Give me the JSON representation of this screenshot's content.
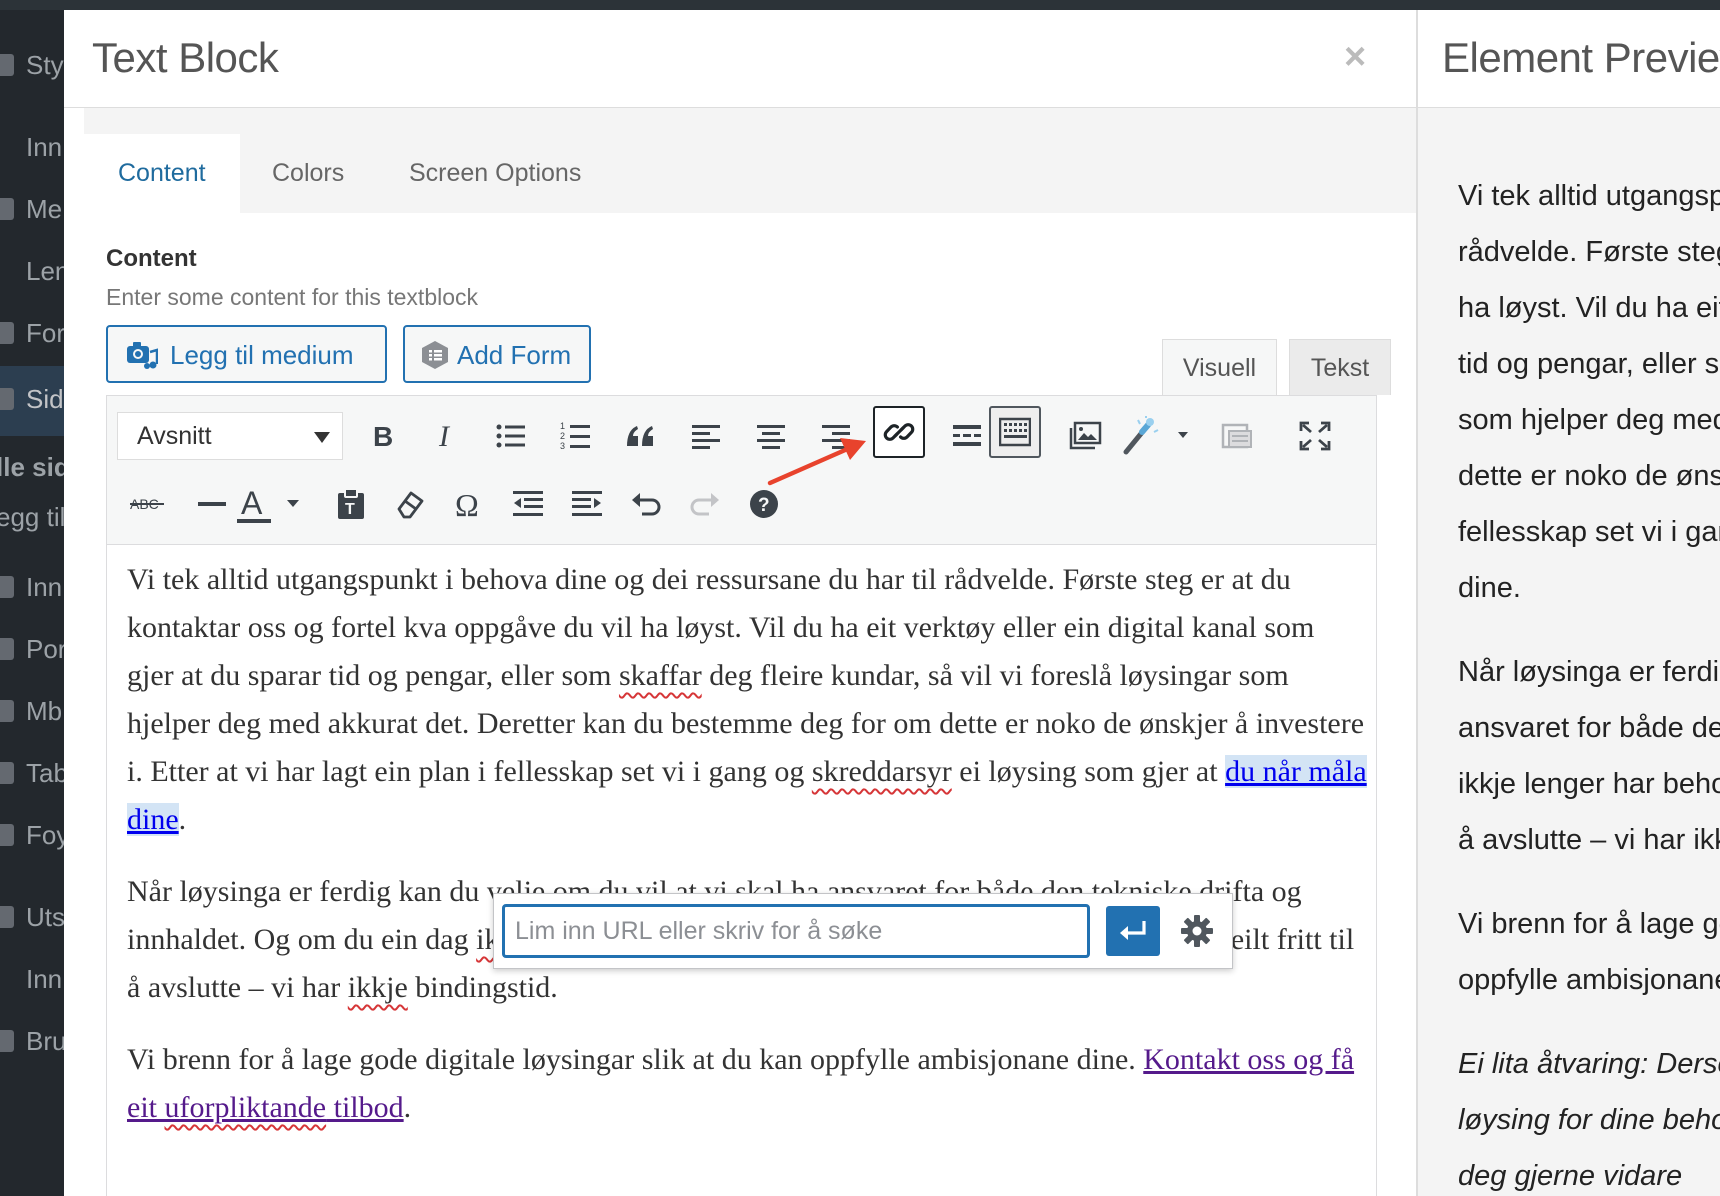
{
  "sidebar": {
    "items": [
      "Sty",
      "Inn",
      "Me",
      "Len",
      "For",
      "Sid",
      "lle sid",
      "egg til",
      "Inn",
      "Por",
      "Mb",
      "Tab",
      "Foy",
      "Uts",
      "Inn",
      "Bru"
    ]
  },
  "modal": {
    "title": "Text Block",
    "close_label": "×",
    "tabs": [
      {
        "label": "Content"
      },
      {
        "label": "Colors"
      },
      {
        "label": "Screen Options"
      }
    ],
    "field_label": "Content",
    "field_description": "Enter some content for this textblock",
    "buttons": {
      "add_media": "Legg til medium",
      "add_form": "Add Form"
    },
    "editor_modes": {
      "visual": "Visuell",
      "text": "Tekst"
    },
    "toolbar": {
      "format_select": "Avsnitt"
    },
    "content": {
      "p1_part1": "Vi tek alltid utgangspunkt i behova dine og dei ressursane du har til rådvelde. Første steg er at du kontaktar oss og fortel kva oppgåve du vil ha løyst. Vil du ha eit verktøy eller ein digital kanal som gjer at du sparar tid og pengar, eller som ",
      "p1_word_skaffar": "skaffar",
      "p1_part2": " deg fleire kundar, så vil vi foreslå løysingar som hjelper deg med akkurat det. Deretter kan du bestemme deg for om dette er noko de ønskjer å investere i. Etter at vi har lagt ein plan i fellesskap set vi i gang og ",
      "p1_word_skreddarsyr": "skreddarsyr",
      "p1_part3": " ei løysing som gjer at ",
      "p1_link": "du når måla dine",
      "p1_end": ".",
      "p2_part1": "Når løysinga er ferdig kan",
      "p2_hidden": " du velje om du vil at vi skal ha ansvaret",
      "p2_part2": " for både den tekniske drifta og innhaldet. Og om du ein dag ",
      "p2_word_ikkje1": "ikkje",
      "p2_part3": " lenger har behov for tenestene våre, så står du sjølvsagt heilt fritt til å avslutte – vi har ",
      "p2_word_ikkje2": "ikkje",
      "p2_part4": " bindingstid.",
      "p3_part1": "Vi brenn for å lage gode digitale løysingar slik at du kan oppfylle ambisjonane dine. ",
      "p3_link_a": "Kontakt oss og få eit ",
      "p3_link_b": "uforpliktande",
      "p3_link_c": " tilbod",
      "p3_end": "."
    },
    "link_popup": {
      "placeholder": "Lim inn URL eller skriv for å søke"
    }
  },
  "preview": {
    "title": "Element Preview",
    "lines_p1": [
      "Vi tek alltid utgangspunkt i",
      "rådvelde. Første steg er at",
      "ha løyst. Vil du ha eit",
      "tid og pengar, eller som",
      "som hjelper deg med",
      "dette er noko de ønskjer",
      "fellesskap set vi i gang",
      "dine."
    ],
    "lines_p2": [
      "Når løysinga er ferdig",
      "ansvaret for både den",
      "ikkje lenger har behov",
      "å avslutte – vi har ikkje"
    ],
    "lines_p3": [
      "Vi brenn for å lage gode",
      "oppfylle ambisjonane"
    ],
    "lines_p4": [
      "Ei lita åtvaring: Dersom",
      "løysing for dine behov",
      "deg gjerne vidare"
    ]
  },
  "colors": {
    "accent": "#2271b1",
    "annotation_arrow": "#e8432d"
  }
}
